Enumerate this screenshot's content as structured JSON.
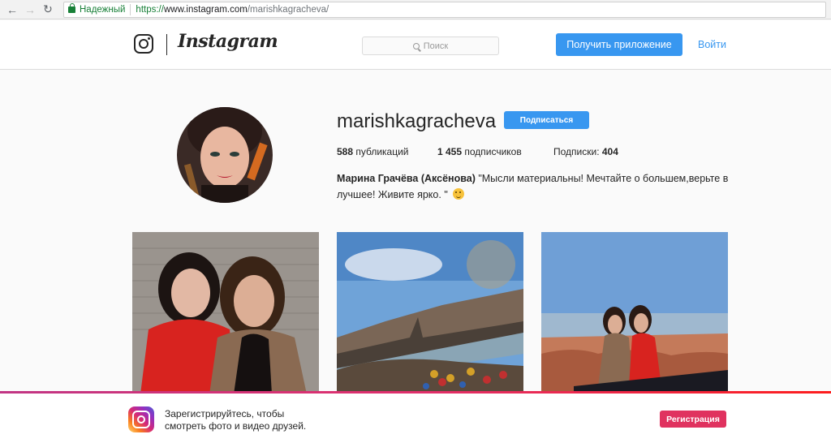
{
  "browser": {
    "secure_label": "Надежный",
    "url_scheme": "https://",
    "url_host": "www.instagram.com",
    "url_path": "/marishkagracheva/"
  },
  "header": {
    "wordmark": "Instagram",
    "search_placeholder": "Поиск",
    "get_app_label": "Получить приложение",
    "login_label": "Войти"
  },
  "profile": {
    "username": "marishkagracheva",
    "follow_label": "Подписаться",
    "posts_count": "588",
    "posts_label": " публикаций",
    "followers_count": "1 455",
    "followers_label": " подписчиков",
    "following_label": "Подписки: ",
    "following_count": "404",
    "full_name": "Марина Грачёва (Аксёнова)",
    "bio_line1": " \"Мысли материальны! Мечтайте о большем,верьте в",
    "bio_line2": "лучшее! Живите ярко. \" "
  },
  "posts": [
    {
      "icon": "photo-two-women-red-coats"
    },
    {
      "icon": "photo-prague-charles-bridge-love-locks"
    },
    {
      "icon": "photo-two-women-prague-view"
    }
  ],
  "banner": {
    "line1": "Зарегистрируйтесь, чтобы",
    "line2": "смотреть фото и видео друзей.",
    "register_label": "Регистрация"
  },
  "colors": {
    "accent": "#3897f0",
    "register": "#e0325f",
    "secure": "#188038"
  }
}
